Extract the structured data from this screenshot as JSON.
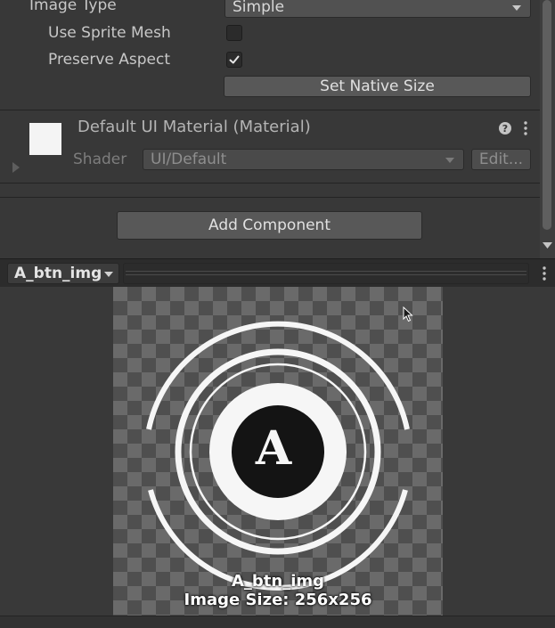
{
  "image_type": {
    "label": "Image Type",
    "value": "Simple"
  },
  "use_sprite_mesh": {
    "label": "Use Sprite Mesh",
    "checked": false
  },
  "preserve_aspect": {
    "label": "Preserve Aspect",
    "checked": true
  },
  "set_native_size_label": "Set Native Size",
  "material": {
    "title": "Default UI Material (Material)",
    "shader_label": "Shader",
    "shader_value": "UI/Default",
    "edit_label": "Edit..."
  },
  "add_component_label": "Add Component",
  "preview": {
    "name_dropdown": "A_btn_img",
    "caption_name": "A_btn_img",
    "caption_size": "Image Size: 256x256",
    "logo_letter": "A"
  },
  "colors": {
    "panel_bg": "#383838",
    "button_bg": "#585858",
    "dropdown_bg": "#515151"
  }
}
